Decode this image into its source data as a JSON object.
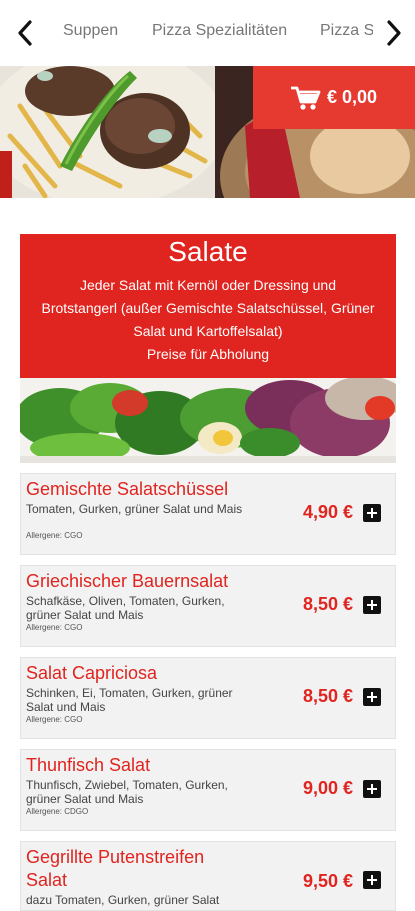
{
  "nav": {
    "tabs": [
      "Suppen",
      "Pizza Spezialitäten",
      "Pizza S"
    ],
    "left_icon": "chevron-left-icon",
    "right_icon": "chevron-right-icon"
  },
  "cart": {
    "total": "€ 0,00",
    "icon": "shopping-cart-icon"
  },
  "section": {
    "title": "Salate",
    "description": "Jeder Salat mit Kernöl oder Dressing und\nBrotstangerl (außer Gemischte Salatschüssel, Grüner\nSalat und Kartoffelsalat)\nPreise für Abholung"
  },
  "items": [
    {
      "name": "Gemischte Salatschüssel",
      "desc": "Tomaten, Gurken, grüner Salat und Mais",
      "allergens": "Allergene: CGO",
      "price": "4,90 €"
    },
    {
      "name": "Griechischer Bauernsalat",
      "desc": "Schafkäse, Oliven, Tomaten, Gurken, grüner Salat und Mais",
      "allergens": "Allergene: CGO",
      "price": "8,50 €"
    },
    {
      "name": "Salat Capriciosa",
      "desc": "Schinken, Ei, Tomaten, Gurken, grüner Salat und Mais",
      "allergens": "Allergene: CGO",
      "price": "8,50 €"
    },
    {
      "name": "Thunfisch Salat",
      "desc": "Thunfisch, Zwiebel, Tomaten, Gurken, grüner Salat und Mais",
      "allergens": "Allergene: CDGO",
      "price": "9,00 €"
    },
    {
      "name": "Gegrillte Putenstreifen Salat",
      "desc": "dazu Tomaten, Gurken, grüner Salat",
      "allergens": "",
      "price": "9,50 €"
    }
  ],
  "colors": {
    "brand_red": "#e0241f",
    "cart_red": "#e63a31",
    "item_bg": "#f2f2f2"
  }
}
